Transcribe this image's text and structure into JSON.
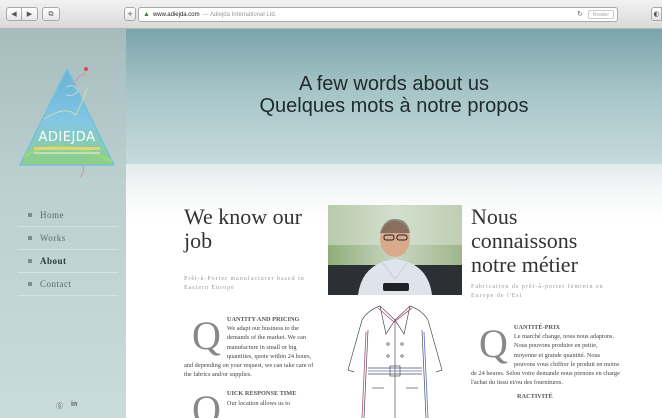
{
  "browser": {
    "url": "www.adiejda.com",
    "url_site_title": "— Adiejda International Ltd.",
    "reader_label": "Reader"
  },
  "sidebar": {
    "logo_text": "ADIEJDA",
    "nav": [
      {
        "label": "Home",
        "active": false
      },
      {
        "label": "Works",
        "active": false
      },
      {
        "label": "About",
        "active": true
      },
      {
        "label": "Contact",
        "active": false
      }
    ],
    "social": [
      "skype-icon",
      "linkedin-icon"
    ]
  },
  "banner": {
    "title_en": "A few words about us",
    "title_fr": "Quelques mots à notre propos"
  },
  "left_col": {
    "heading": "We know our job",
    "subheading": "Prêt-à-Porter manufacturer based in Eastern Europe",
    "drop_letter": "Q",
    "block1_title": "UANTITY AND PRICING",
    "block1_text": "We adapt our business to the demands of the market. We can manufacture in small or big quantities, quote within 24 hours, and depending on your request, we can take care of the fabrics and/or supplies.",
    "block2_drop": "Q",
    "block2_title": "UICK RESPONSE TIME",
    "block2_text": "Our location allows us to"
  },
  "right_col": {
    "heading": "Nous connaissons notre métier",
    "subheading": "Fabrication de prêt-à-porter féminin en Europe de l'Est",
    "drop_letter": "Q",
    "block1_title": "UANTITÉ-PRIX",
    "block1_text": "Le marché change, nous nous adaptons. Nous pouvons produire en petite, moyenne et grande quantité. Nous pouvons vous chiffrer le produit en moins de 24 heures. Selon votre demande nous prenons en charge l'achat du tissu et/ou des fournitures.",
    "block2_title": "RACTIVITÉ"
  },
  "colors": {
    "banner_top": "#7aa4ab",
    "sidebar": "#b8cccd",
    "text": "#333333"
  }
}
